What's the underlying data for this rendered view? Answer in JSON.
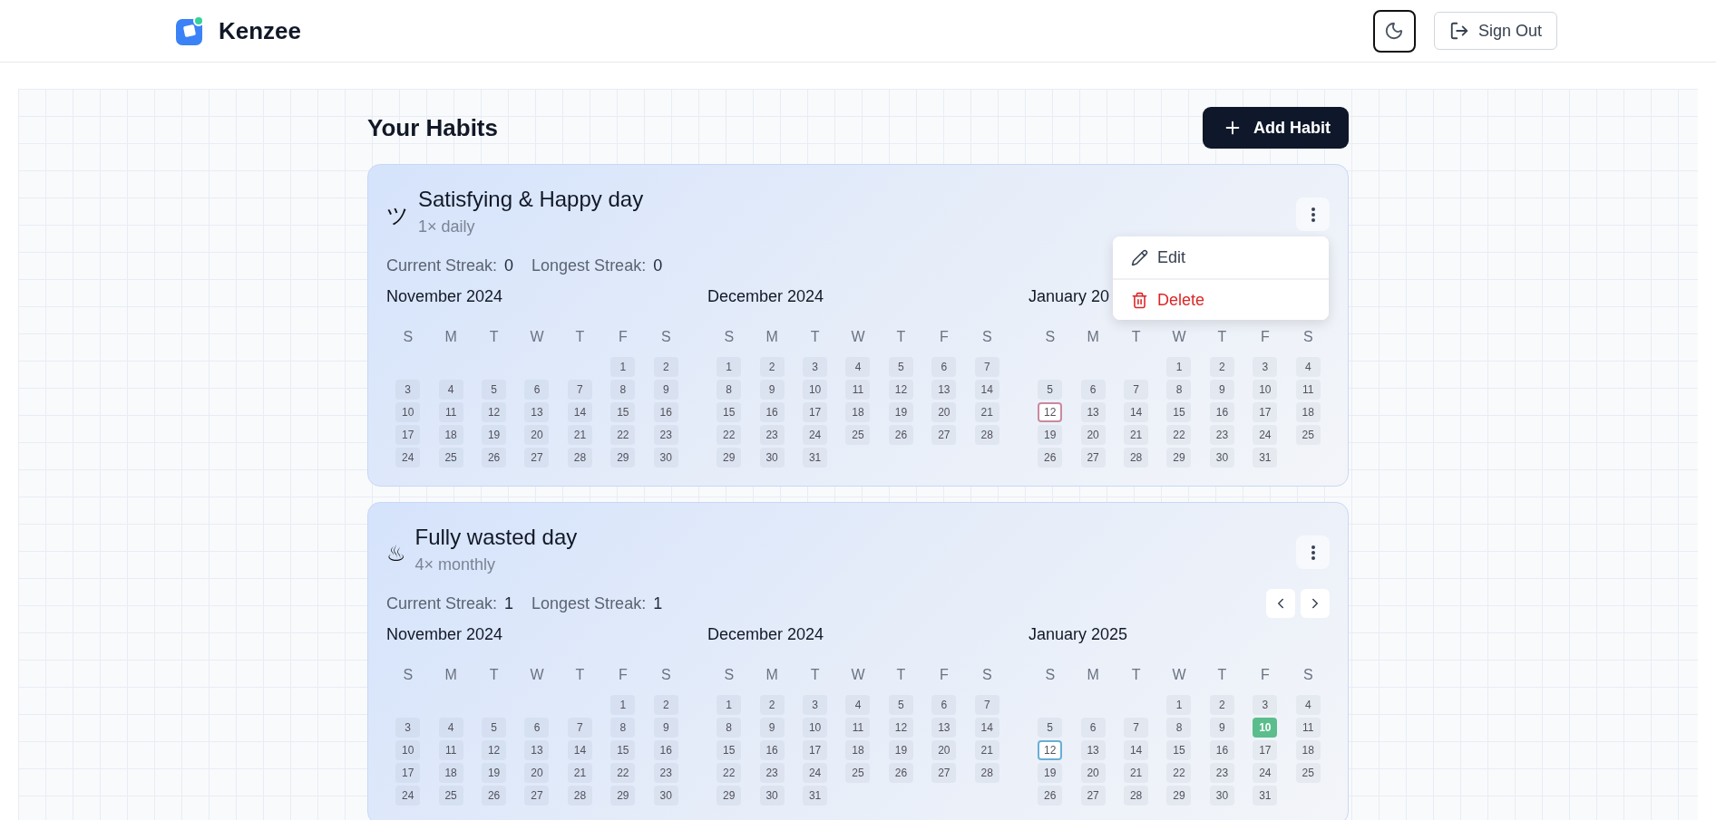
{
  "header": {
    "brand": "Kenzee",
    "sign_out": "Sign Out"
  },
  "page": {
    "title": "Your Habits",
    "add_button": "Add Habit"
  },
  "habits": [
    {
      "icon": "ツ",
      "title": "Satisfying & Happy day",
      "frequency": "1× daily",
      "color": "#c98a9e",
      "nav_arrows": false,
      "streaks": [
        {
          "label": "Current Streak:",
          "value": "0"
        },
        {
          "label": "Longest Streak:",
          "value": "0"
        }
      ],
      "menu": {
        "items": [
          {
            "kind": "edit",
            "label": "Edit"
          },
          {
            "kind": "delete",
            "label": "Delete"
          }
        ]
      },
      "months": [
        {
          "title": "November 2024",
          "weekdays": [
            "S",
            "M",
            "T",
            "W",
            "T",
            "F",
            "S"
          ],
          "days": [
            {
              "kind": "blank"
            },
            {
              "kind": "blank"
            },
            {
              "kind": "blank"
            },
            {
              "kind": "blank"
            },
            {
              "kind": "blank"
            },
            {
              "kind": "day",
              "n": "1",
              "today": false,
              "done": false
            },
            {
              "kind": "day",
              "n": "2",
              "today": false,
              "done": false
            },
            {
              "kind": "day",
              "n": "3",
              "today": false,
              "done": false
            },
            {
              "kind": "day",
              "n": "4",
              "today": false,
              "done": false
            },
            {
              "kind": "day",
              "n": "5",
              "today": false,
              "done": false
            },
            {
              "kind": "day",
              "n": "6",
              "today": false,
              "done": false
            },
            {
              "kind": "day",
              "n": "7",
              "today": false,
              "done": false
            },
            {
              "kind": "day",
              "n": "8",
              "today": false,
              "done": false
            },
            {
              "kind": "day",
              "n": "9",
              "today": false,
              "done": false
            },
            {
              "kind": "day",
              "n": "10",
              "today": false,
              "done": false
            },
            {
              "kind": "day",
              "n": "11",
              "today": false,
              "done": false
            },
            {
              "kind": "day",
              "n": "12",
              "today": false,
              "done": false
            },
            {
              "kind": "day",
              "n": "13",
              "today": false,
              "done": false
            },
            {
              "kind": "day",
              "n": "14",
              "today": false,
              "done": false
            },
            {
              "kind": "day",
              "n": "15",
              "today": false,
              "done": false
            },
            {
              "kind": "day",
              "n": "16",
              "today": false,
              "done": false
            },
            {
              "kind": "day",
              "n": "17",
              "today": false,
              "done": false
            },
            {
              "kind": "day",
              "n": "18",
              "today": false,
              "done": false
            },
            {
              "kind": "day",
              "n": "19",
              "today": false,
              "done": false
            },
            {
              "kind": "day",
              "n": "20",
              "today": false,
              "done": false
            },
            {
              "kind": "day",
              "n": "21",
              "today": false,
              "done": false
            },
            {
              "kind": "day",
              "n": "22",
              "today": false,
              "done": false
            },
            {
              "kind": "day",
              "n": "23",
              "today": false,
              "done": false
            },
            {
              "kind": "day",
              "n": "24",
              "today": false,
              "done": false
            },
            {
              "kind": "day",
              "n": "25",
              "today": false,
              "done": false
            },
            {
              "kind": "day",
              "n": "26",
              "today": false,
              "done": false
            },
            {
              "kind": "day",
              "n": "27",
              "today": false,
              "done": false
            },
            {
              "kind": "day",
              "n": "28",
              "today": false,
              "done": false
            },
            {
              "kind": "day",
              "n": "29",
              "today": false,
              "done": false
            },
            {
              "kind": "day",
              "n": "30",
              "today": false,
              "done": false
            }
          ]
        },
        {
          "title": "December 2024",
          "weekdays": [
            "S",
            "M",
            "T",
            "W",
            "T",
            "F",
            "S"
          ],
          "days": [
            {
              "kind": "day",
              "n": "1",
              "today": false,
              "done": false
            },
            {
              "kind": "day",
              "n": "2",
              "today": false,
              "done": false
            },
            {
              "kind": "day",
              "n": "3",
              "today": false,
              "done": false
            },
            {
              "kind": "day",
              "n": "4",
              "today": false,
              "done": false
            },
            {
              "kind": "day",
              "n": "5",
              "today": false,
              "done": false
            },
            {
              "kind": "day",
              "n": "6",
              "today": false,
              "done": false
            },
            {
              "kind": "day",
              "n": "7",
              "today": false,
              "done": false
            },
            {
              "kind": "day",
              "n": "8",
              "today": false,
              "done": false
            },
            {
              "kind": "day",
              "n": "9",
              "today": false,
              "done": false
            },
            {
              "kind": "day",
              "n": "10",
              "today": false,
              "done": false
            },
            {
              "kind": "day",
              "n": "11",
              "today": false,
              "done": false
            },
            {
              "kind": "day",
              "n": "12",
              "today": false,
              "done": false
            },
            {
              "kind": "day",
              "n": "13",
              "today": false,
              "done": false
            },
            {
              "kind": "day",
              "n": "14",
              "today": false,
              "done": false
            },
            {
              "kind": "day",
              "n": "15",
              "today": false,
              "done": false
            },
            {
              "kind": "day",
              "n": "16",
              "today": false,
              "done": false
            },
            {
              "kind": "day",
              "n": "17",
              "today": false,
              "done": false
            },
            {
              "kind": "day",
              "n": "18",
              "today": false,
              "done": false
            },
            {
              "kind": "day",
              "n": "19",
              "today": false,
              "done": false
            },
            {
              "kind": "day",
              "n": "20",
              "today": false,
              "done": false
            },
            {
              "kind": "day",
              "n": "21",
              "today": false,
              "done": false
            },
            {
              "kind": "day",
              "n": "22",
              "today": false,
              "done": false
            },
            {
              "kind": "day",
              "n": "23",
              "today": false,
              "done": false
            },
            {
              "kind": "day",
              "n": "24",
              "today": false,
              "done": false
            },
            {
              "kind": "day",
              "n": "25",
              "today": false,
              "done": false
            },
            {
              "kind": "day",
              "n": "26",
              "today": false,
              "done": false
            },
            {
              "kind": "day",
              "n": "27",
              "today": false,
              "done": false
            },
            {
              "kind": "day",
              "n": "28",
              "today": false,
              "done": false
            },
            {
              "kind": "day",
              "n": "29",
              "today": false,
              "done": false
            },
            {
              "kind": "day",
              "n": "30",
              "today": false,
              "done": false
            },
            {
              "kind": "day",
              "n": "31",
              "today": false,
              "done": false
            }
          ]
        },
        {
          "title": "January 20",
          "weekdays": [
            "S",
            "M",
            "T",
            "W",
            "T",
            "F",
            "S"
          ],
          "days": [
            {
              "kind": "blank"
            },
            {
              "kind": "blank"
            },
            {
              "kind": "blank"
            },
            {
              "kind": "day",
              "n": "1",
              "today": false,
              "done": false
            },
            {
              "kind": "day",
              "n": "2",
              "today": false,
              "done": false
            },
            {
              "kind": "day",
              "n": "3",
              "today": false,
              "done": false
            },
            {
              "kind": "day",
              "n": "4",
              "today": false,
              "done": false
            },
            {
              "kind": "day",
              "n": "5",
              "today": false,
              "done": false
            },
            {
              "kind": "day",
              "n": "6",
              "today": false,
              "done": false
            },
            {
              "kind": "day",
              "n": "7",
              "today": false,
              "done": false
            },
            {
              "kind": "day",
              "n": "8",
              "today": false,
              "done": false
            },
            {
              "kind": "day",
              "n": "9",
              "today": false,
              "done": false
            },
            {
              "kind": "day",
              "n": "10",
              "today": false,
              "done": false
            },
            {
              "kind": "day",
              "n": "11",
              "today": false,
              "done": false
            },
            {
              "kind": "day",
              "n": "12",
              "today": true,
              "done": false
            },
            {
              "kind": "day",
              "n": "13",
              "today": false,
              "done": false
            },
            {
              "kind": "day",
              "n": "14",
              "today": false,
              "done": false
            },
            {
              "kind": "day",
              "n": "15",
              "today": false,
              "done": false
            },
            {
              "kind": "day",
              "n": "16",
              "today": false,
              "done": false
            },
            {
              "kind": "day",
              "n": "17",
              "today": false,
              "done": false
            },
            {
              "kind": "day",
              "n": "18",
              "today": false,
              "done": false
            },
            {
              "kind": "day",
              "n": "19",
              "today": false,
              "done": false
            },
            {
              "kind": "day",
              "n": "20",
              "today": false,
              "done": false
            },
            {
              "kind": "day",
              "n": "21",
              "today": false,
              "done": false
            },
            {
              "kind": "day",
              "n": "22",
              "today": false,
              "done": false
            },
            {
              "kind": "day",
              "n": "23",
              "today": false,
              "done": false
            },
            {
              "kind": "day",
              "n": "24",
              "today": false,
              "done": false
            },
            {
              "kind": "day",
              "n": "25",
              "today": false,
              "done": false
            },
            {
              "kind": "day",
              "n": "26",
              "today": false,
              "done": false
            },
            {
              "kind": "day",
              "n": "27",
              "today": false,
              "done": false
            },
            {
              "kind": "day",
              "n": "28",
              "today": false,
              "done": false
            },
            {
              "kind": "day",
              "n": "29",
              "today": false,
              "done": false
            },
            {
              "kind": "day",
              "n": "30",
              "today": false,
              "done": false
            },
            {
              "kind": "day",
              "n": "31",
              "today": false,
              "done": false
            }
          ]
        }
      ]
    },
    {
      "icon": "♨",
      "title": "Fully wasted day",
      "frequency": "4× monthly",
      "color": "#6aaed6",
      "nav_arrows": true,
      "streaks": [
        {
          "label": "Current Streak:",
          "value": "1"
        },
        {
          "label": "Longest Streak:",
          "value": "1"
        }
      ],
      "months": [
        {
          "title": "November 2024",
          "weekdays": [
            "S",
            "M",
            "T",
            "W",
            "T",
            "F",
            "S"
          ],
          "days": [
            {
              "kind": "blank"
            },
            {
              "kind": "blank"
            },
            {
              "kind": "blank"
            },
            {
              "kind": "blank"
            },
            {
              "kind": "blank"
            },
            {
              "kind": "day",
              "n": "1",
              "today": false,
              "done": false
            },
            {
              "kind": "day",
              "n": "2",
              "today": false,
              "done": false
            },
            {
              "kind": "day",
              "n": "3",
              "today": false,
              "done": false
            },
            {
              "kind": "day",
              "n": "4",
              "today": false,
              "done": false
            },
            {
              "kind": "day",
              "n": "5",
              "today": false,
              "done": false
            },
            {
              "kind": "day",
              "n": "6",
              "today": false,
              "done": false
            },
            {
              "kind": "day",
              "n": "7",
              "today": false,
              "done": false
            },
            {
              "kind": "day",
              "n": "8",
              "today": false,
              "done": false
            },
            {
              "kind": "day",
              "n": "9",
              "today": false,
              "done": false
            },
            {
              "kind": "day",
              "n": "10",
              "today": false,
              "done": false
            },
            {
              "kind": "day",
              "n": "11",
              "today": false,
              "done": false
            },
            {
              "kind": "day",
              "n": "12",
              "today": false,
              "done": false
            },
            {
              "kind": "day",
              "n": "13",
              "today": false,
              "done": false
            },
            {
              "kind": "day",
              "n": "14",
              "today": false,
              "done": false
            },
            {
              "kind": "day",
              "n": "15",
              "today": false,
              "done": false
            },
            {
              "kind": "day",
              "n": "16",
              "today": false,
              "done": false
            },
            {
              "kind": "day",
              "n": "17",
              "today": false,
              "done": false
            },
            {
              "kind": "day",
              "n": "18",
              "today": false,
              "done": false
            },
            {
              "kind": "day",
              "n": "19",
              "today": false,
              "done": false
            },
            {
              "kind": "day",
              "n": "20",
              "today": false,
              "done": false
            },
            {
              "kind": "day",
              "n": "21",
              "today": false,
              "done": false
            },
            {
              "kind": "day",
              "n": "22",
              "today": false,
              "done": false
            },
            {
              "kind": "day",
              "n": "23",
              "today": false,
              "done": false
            },
            {
              "kind": "day",
              "n": "24",
              "today": false,
              "done": false
            },
            {
              "kind": "day",
              "n": "25",
              "today": false,
              "done": false
            },
            {
              "kind": "day",
              "n": "26",
              "today": false,
              "done": false
            },
            {
              "kind": "day",
              "n": "27",
              "today": false,
              "done": false
            },
            {
              "kind": "day",
              "n": "28",
              "today": false,
              "done": false
            },
            {
              "kind": "day",
              "n": "29",
              "today": false,
              "done": false
            },
            {
              "kind": "day",
              "n": "30",
              "today": false,
              "done": false
            }
          ]
        },
        {
          "title": "December 2024",
          "weekdays": [
            "S",
            "M",
            "T",
            "W",
            "T",
            "F",
            "S"
          ],
          "days": [
            {
              "kind": "day",
              "n": "1",
              "today": false,
              "done": false
            },
            {
              "kind": "day",
              "n": "2",
              "today": false,
              "done": false
            },
            {
              "kind": "day",
              "n": "3",
              "today": false,
              "done": false
            },
            {
              "kind": "day",
              "n": "4",
              "today": false,
              "done": false
            },
            {
              "kind": "day",
              "n": "5",
              "today": false,
              "done": false
            },
            {
              "kind": "day",
              "n": "6",
              "today": false,
              "done": false
            },
            {
              "kind": "day",
              "n": "7",
              "today": false,
              "done": false
            },
            {
              "kind": "day",
              "n": "8",
              "today": false,
              "done": false
            },
            {
              "kind": "day",
              "n": "9",
              "today": false,
              "done": false
            },
            {
              "kind": "day",
              "n": "10",
              "today": false,
              "done": false
            },
            {
              "kind": "day",
              "n": "11",
              "today": false,
              "done": false
            },
            {
              "kind": "day",
              "n": "12",
              "today": false,
              "done": false
            },
            {
              "kind": "day",
              "n": "13",
              "today": false,
              "done": false
            },
            {
              "kind": "day",
              "n": "14",
              "today": false,
              "done": false
            },
            {
              "kind": "day",
              "n": "15",
              "today": false,
              "done": false
            },
            {
              "kind": "day",
              "n": "16",
              "today": false,
              "done": false
            },
            {
              "kind": "day",
              "n": "17",
              "today": false,
              "done": false
            },
            {
              "kind": "day",
              "n": "18",
              "today": false,
              "done": false
            },
            {
              "kind": "day",
              "n": "19",
              "today": false,
              "done": false
            },
            {
              "kind": "day",
              "n": "20",
              "today": false,
              "done": false
            },
            {
              "kind": "day",
              "n": "21",
              "today": false,
              "done": false
            },
            {
              "kind": "day",
              "n": "22",
              "today": false,
              "done": false
            },
            {
              "kind": "day",
              "n": "23",
              "today": false,
              "done": false
            },
            {
              "kind": "day",
              "n": "24",
              "today": false,
              "done": false
            },
            {
              "kind": "day",
              "n": "25",
              "today": false,
              "done": false
            },
            {
              "kind": "day",
              "n": "26",
              "today": false,
              "done": false
            },
            {
              "kind": "day",
              "n": "27",
              "today": false,
              "done": false
            },
            {
              "kind": "day",
              "n": "28",
              "today": false,
              "done": false
            },
            {
              "kind": "day",
              "n": "29",
              "today": false,
              "done": false
            },
            {
              "kind": "day",
              "n": "30",
              "today": false,
              "done": false
            },
            {
              "kind": "day",
              "n": "31",
              "today": false,
              "done": false
            }
          ]
        },
        {
          "title": "January 2025",
          "weekdays": [
            "S",
            "M",
            "T",
            "W",
            "T",
            "F",
            "S"
          ],
          "days": [
            {
              "kind": "blank"
            },
            {
              "kind": "blank"
            },
            {
              "kind": "blank"
            },
            {
              "kind": "day",
              "n": "1",
              "today": false,
              "done": false
            },
            {
              "kind": "day",
              "n": "2",
              "today": false,
              "done": false
            },
            {
              "kind": "day",
              "n": "3",
              "today": false,
              "done": false
            },
            {
              "kind": "day",
              "n": "4",
              "today": false,
              "done": false
            },
            {
              "kind": "day",
              "n": "5",
              "today": false,
              "done": false
            },
            {
              "kind": "day",
              "n": "6",
              "today": false,
              "done": false
            },
            {
              "kind": "day",
              "n": "7",
              "today": false,
              "done": false
            },
            {
              "kind": "day",
              "n": "8",
              "today": false,
              "done": false
            },
            {
              "kind": "day",
              "n": "9",
              "today": false,
              "done": false
            },
            {
              "kind": "day",
              "n": "10",
              "today": false,
              "done": true
            },
            {
              "kind": "day",
              "n": "11",
              "today": false,
              "done": false
            },
            {
              "kind": "day",
              "n": "12",
              "today": true,
              "done": false
            },
            {
              "kind": "day",
              "n": "13",
              "today": false,
              "done": false
            },
            {
              "kind": "day",
              "n": "14",
              "today": false,
              "done": false
            },
            {
              "kind": "day",
              "n": "15",
              "today": false,
              "done": false
            },
            {
              "kind": "day",
              "n": "16",
              "today": false,
              "done": false
            },
            {
              "kind": "day",
              "n": "17",
              "today": false,
              "done": false
            },
            {
              "kind": "day",
              "n": "18",
              "today": false,
              "done": false
            },
            {
              "kind": "day",
              "n": "19",
              "today": false,
              "done": false
            },
            {
              "kind": "day",
              "n": "20",
              "today": false,
              "done": false
            },
            {
              "kind": "day",
              "n": "21",
              "today": false,
              "done": false
            },
            {
              "kind": "day",
              "n": "22",
              "today": false,
              "done": false
            },
            {
              "kind": "day",
              "n": "23",
              "today": false,
              "done": false
            },
            {
              "kind": "day",
              "n": "24",
              "today": false,
              "done": false
            },
            {
              "kind": "day",
              "n": "25",
              "today": false,
              "done": false
            },
            {
              "kind": "day",
              "n": "26",
              "today": false,
              "done": false
            },
            {
              "kind": "day",
              "n": "27",
              "today": false,
              "done": false
            },
            {
              "kind": "day",
              "n": "28",
              "today": false,
              "done": false
            },
            {
              "kind": "day",
              "n": "29",
              "today": false,
              "done": false
            },
            {
              "kind": "day",
              "n": "30",
              "today": false,
              "done": false
            },
            {
              "kind": "day",
              "n": "31",
              "today": false,
              "done": false
            }
          ]
        }
      ]
    }
  ]
}
